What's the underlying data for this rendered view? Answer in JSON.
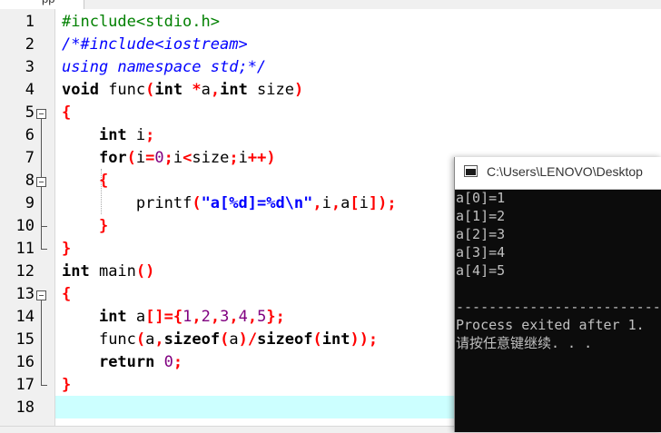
{
  "tab": {
    "label": "pp"
  },
  "editor": {
    "line_numbers": [
      "1",
      "2",
      "3",
      "4",
      "5",
      "6",
      "7",
      "8",
      "9",
      "10",
      "11",
      "12",
      "13",
      "14",
      "15",
      "16",
      "17",
      "18"
    ]
  },
  "code": {
    "l1": {
      "pp": "#include<stdio.h>"
    },
    "l2": {
      "cm": "/*#include<iostream>"
    },
    "l3": {
      "cm": "using namespace std;*/"
    },
    "l4": {
      "kw1": "void",
      "t1": " func",
      "s1": "(",
      "kw2": "int",
      "s2": " *",
      "t2": "a",
      "s3": ",",
      "kw3": "int",
      "t3": " size",
      "s4": ")"
    },
    "l5": {
      "s1": "{"
    },
    "l6": {
      "ind": "    ",
      "kw1": "int",
      "t1": " i",
      "s1": ";"
    },
    "l7": {
      "ind": "    ",
      "kw1": "for",
      "s1": "(",
      "t1": "i",
      "s2": "=",
      "n1": "0",
      "s3": ";",
      "t2": "i",
      "s4": "<",
      "t3": "size",
      "s5": ";",
      "t4": "i",
      "s6": "++)"
    },
    "l8": {
      "ind": "    ",
      "s1": "{"
    },
    "l9": {
      "ind": "        ",
      "t1": "printf",
      "s1": "(",
      "str1": "\"a[%d]=%d\\n\"",
      "s2": ",",
      "t2": "i",
      "s3": ",",
      "t3": "a",
      "s4": "[",
      "t4": "i",
      "s5": "]);"
    },
    "l10": {
      "ind": "    ",
      "s1": "}"
    },
    "l11": {
      "s1": "}"
    },
    "l12": {
      "kw1": "int",
      "t1": " main",
      "s1": "()"
    },
    "l13": {
      "s1": "{"
    },
    "l14": {
      "ind": "    ",
      "kw1": "int",
      "t1": " a",
      "s1": "[]={",
      "n1": "1",
      "s2": ",",
      "n2": "2",
      "s3": ",",
      "n3": "3",
      "s4": ",",
      "n4": "4",
      "s5": ",",
      "n5": "5",
      "s6": "};"
    },
    "l15": {
      "ind": "    ",
      "t1": "func",
      "s1": "(",
      "t2": "a",
      "s2": ",",
      "kw1": "sizeof",
      "s3": "(",
      "t3": "a",
      "s4": ")/",
      "kw2": "sizeof",
      "s5": "(",
      "kw3": "int",
      "s6": "));"
    },
    "l16": {
      "ind": "    ",
      "kw1": "return",
      "n1": " 0",
      "s1": ";"
    },
    "l17": {
      "s1": "}"
    }
  },
  "console": {
    "title": "C:\\Users\\LENOVO\\Desktop",
    "lines": [
      "a[0]=1",
      "a[1]=2",
      "a[2]=3",
      "a[3]=4",
      "a[4]=5",
      "",
      "--------------------------------",
      "Process exited after 1.",
      "请按任意键继续. . ."
    ]
  }
}
